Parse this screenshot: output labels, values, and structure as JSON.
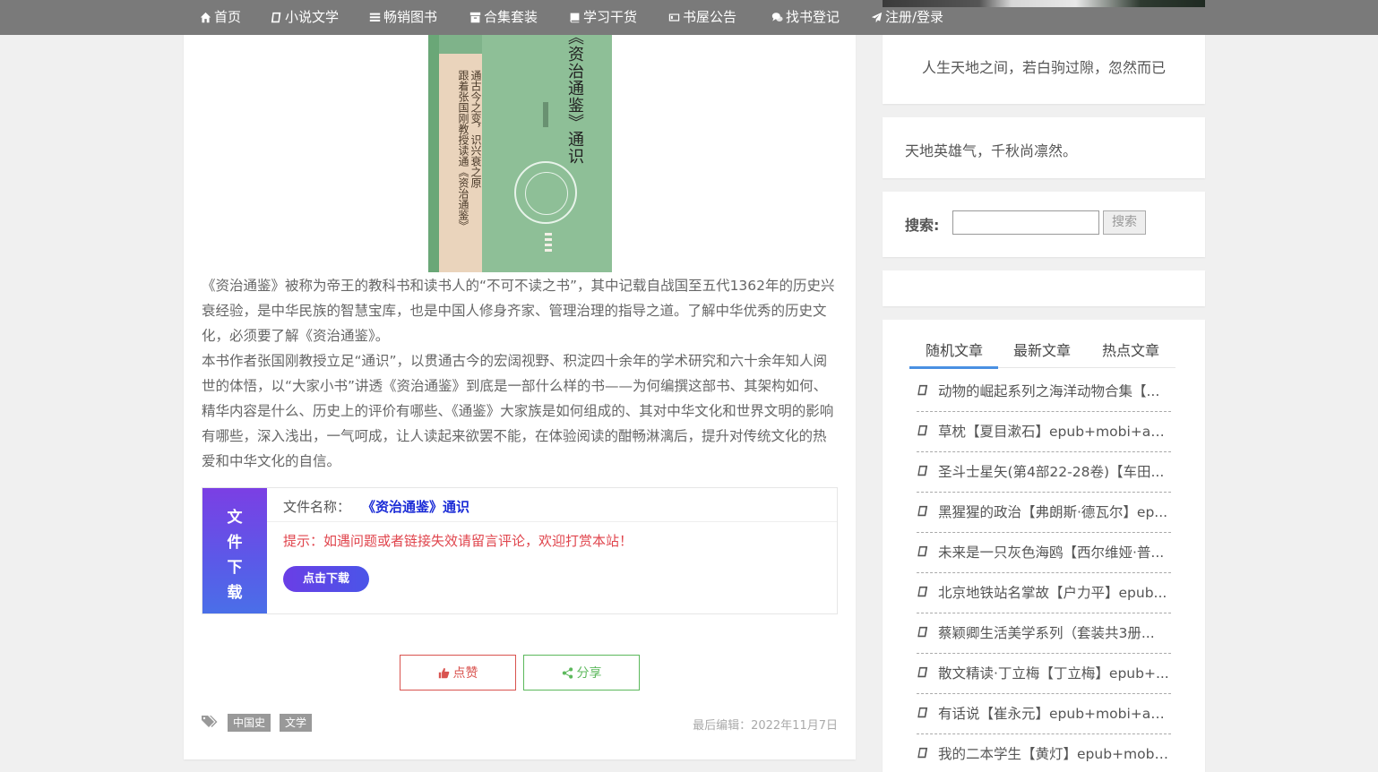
{
  "nav": {
    "home": "首页",
    "novels": "小说文学",
    "bestsellers": "畅销图书",
    "collections": "合集套装",
    "study": "学习干货",
    "notice": "书屋公告",
    "find_book": "找书登记",
    "register": "注册/登录"
  },
  "cover": {
    "title": "《资治通鉴》通识",
    "subtitle": "通古今之变，识兴衰之原",
    "subtitle2": "跟着张国刚教授读通《资治通鉴》"
  },
  "article": {
    "para1": "《资治通鉴》被称为帝王的教科书和读书人的“不可不读之书”，其中记载自战国至五代1362年的历史兴衰经验，是中华民族的智慧宝库，也是中国人修身齐家、管理治理的指导之道。了解中华优秀的历史文化，必须要了解《资治通鉴》。",
    "para2": "本书作者张国刚教授立足“通识”，以贯通古今的宏阔视野、积淀四十余年的学术研究和六十余年知人阅世的体悟，以“大家小书”讲透《资治通鉴》到底是一部什么样的书——为何编撰这部书、其架构如何、精华内容是什么、历史上的评价有哪些、《通鉴》大家族是如何组成的、其对中华文化和世界文明的影响有哪些，深入浅出，一气呵成，让人读起来欲罢不能，在体验阅读的酣畅淋漓后，提升对传统文化的热爱和中华文化的自信。"
  },
  "download": {
    "side_chars": [
      "文",
      "件",
      "下",
      "载"
    ],
    "name_label": "文件名称：",
    "name_value": "《资治通鉴》通识",
    "tip": "提示：如遇问题或者链接失效请留言评论，欢迎打赏本站！",
    "button": "点击下载"
  },
  "actions": {
    "like": "点赞",
    "share": "分享"
  },
  "tags": [
    "中国史",
    "文学"
  ],
  "last_edit": "最后编辑：2022年11月7日",
  "sidebar": {
    "quote1": "人生天地之间，若白驹过隙，忽然而已",
    "quote2": "天地英雄气，千秋尚凛然。",
    "search_label": "搜索:",
    "search_button": "搜索",
    "tabs": [
      "随机文章",
      "最新文章",
      "热点文章"
    ],
    "articles": [
      "动物的崛起系列之海洋动物合集【...",
      "草枕【夏目漱石】epub+mobi+az...",
      "圣斗士星矢(第4部22-28卷)【车田...",
      "黑猩猩的政治【弗朗斯·德瓦尔】ep...",
      "未来是一只灰色海鸥【西尔维娅·普...",
      "北京地铁站名掌故【户力平】epub...",
      "蔡颖卿生活美学系列（套装共3册...",
      "散文精读·丁立梅【丁立梅】epub+...",
      "有话说【崔永元】epub+mobi+az...",
      "我的二本学生【黄灯】epub+mobi..."
    ]
  },
  "colors": {
    "nav_bg": "#7a7a7a",
    "download_gradient_start": "#7b3fe4",
    "download_gradient_end": "#4a6fe8",
    "tip_red": "#e0454d",
    "file_name_blue": "#1a2bd6",
    "tab_active": "#4a90e2",
    "like": "#d9534f",
    "share": "#5cb85c"
  }
}
